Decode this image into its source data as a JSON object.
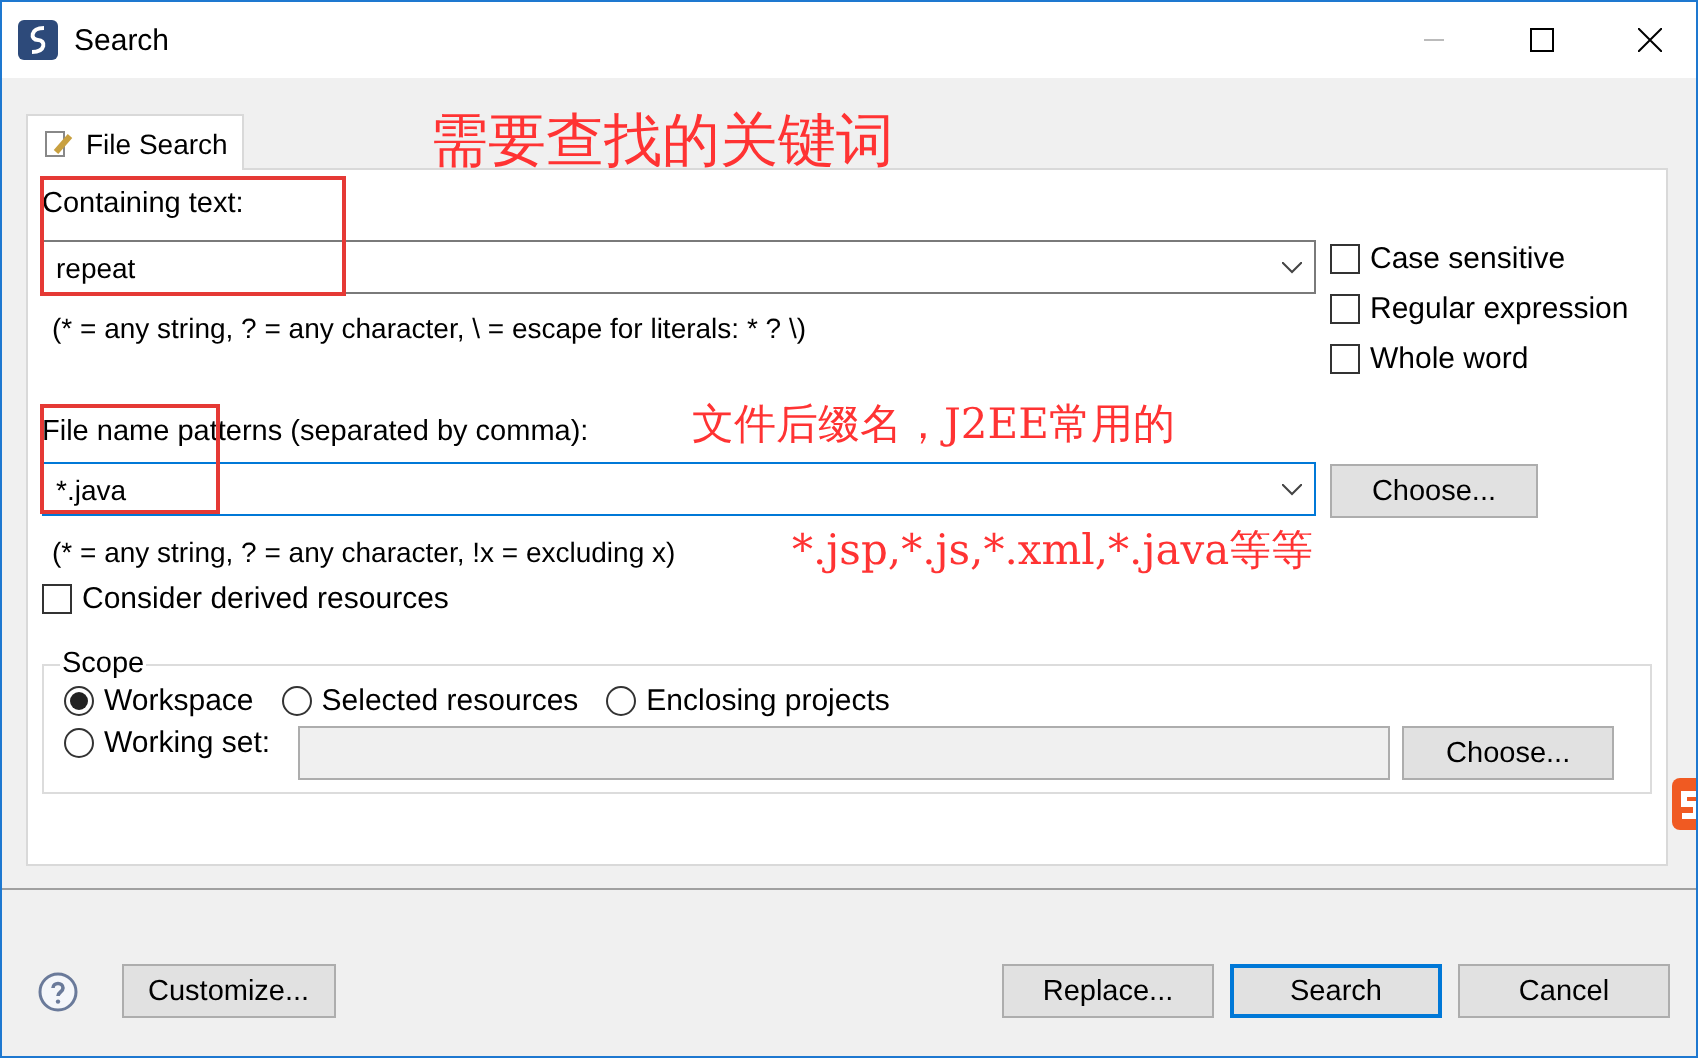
{
  "window": {
    "title": "Search"
  },
  "tabs": [
    {
      "label": "File Search",
      "selected": true
    }
  ],
  "containing_text": {
    "label": "Containing text:",
    "value": "repeat",
    "hint": "(* = any string, ? = any character, \\ = escape for literals: * ? \\)"
  },
  "options": [
    {
      "label": "Case sensitive",
      "checked": false
    },
    {
      "label": "Regular expression",
      "checked": false
    },
    {
      "label": "Whole word",
      "checked": false
    }
  ],
  "file_name_patterns": {
    "label": "File name patterns (separated by comma):",
    "value": "*.java",
    "button": "Choose...",
    "hint": "(* = any string, ? = any character, !x = excluding x)"
  },
  "derived": {
    "label": "Consider derived resources",
    "checked": false
  },
  "scope": {
    "title": "Scope",
    "options": [
      {
        "label": "Workspace",
        "selected": true
      },
      {
        "label": "Selected resources",
        "selected": false
      },
      {
        "label": "Enclosing projects",
        "selected": false
      },
      {
        "label": "Working set:",
        "selected": false
      }
    ],
    "button": "Choose..."
  },
  "buttons": [
    {
      "label": "Customize...",
      "default": false
    },
    {
      "label": "Replace...",
      "default": false
    },
    {
      "label": "Search",
      "default": true
    },
    {
      "label": "Cancel",
      "default": false
    }
  ],
  "annotations": [
    "需要查找的关键词",
    "文件后缀名，J2EE常用的",
    "*.jsp,*.js,*.xml,*.java等等"
  ]
}
